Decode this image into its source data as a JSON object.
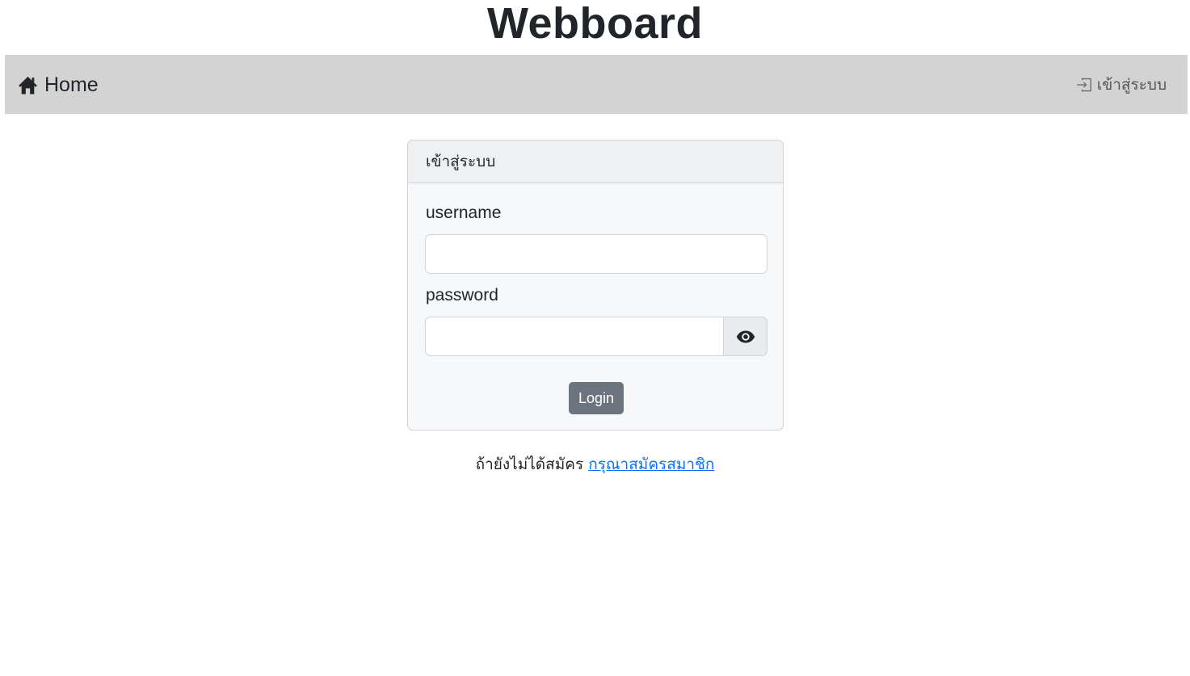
{
  "header": {
    "title": "Webboard"
  },
  "navbar": {
    "home_icon": "house-icon",
    "home_label": "Home",
    "login_icon": "box-arrow-in-right-icon",
    "login_label": "เข้าสู่ระบบ"
  },
  "login_card": {
    "title": "เข้าสู่ระบบ",
    "username_label": "username",
    "username_value": "",
    "password_label": "password",
    "password_value": "",
    "toggle_icon": "eye-icon",
    "submit_label": "Login"
  },
  "register": {
    "prompt": "ถ้ายังไม่ได้สมัคร",
    "link_label": "กรุณาสมัครสมาชิก"
  },
  "colors": {
    "navbar_bg": "#d3d3d3",
    "button_bg": "#6c757d",
    "link": "#0d6efd"
  }
}
